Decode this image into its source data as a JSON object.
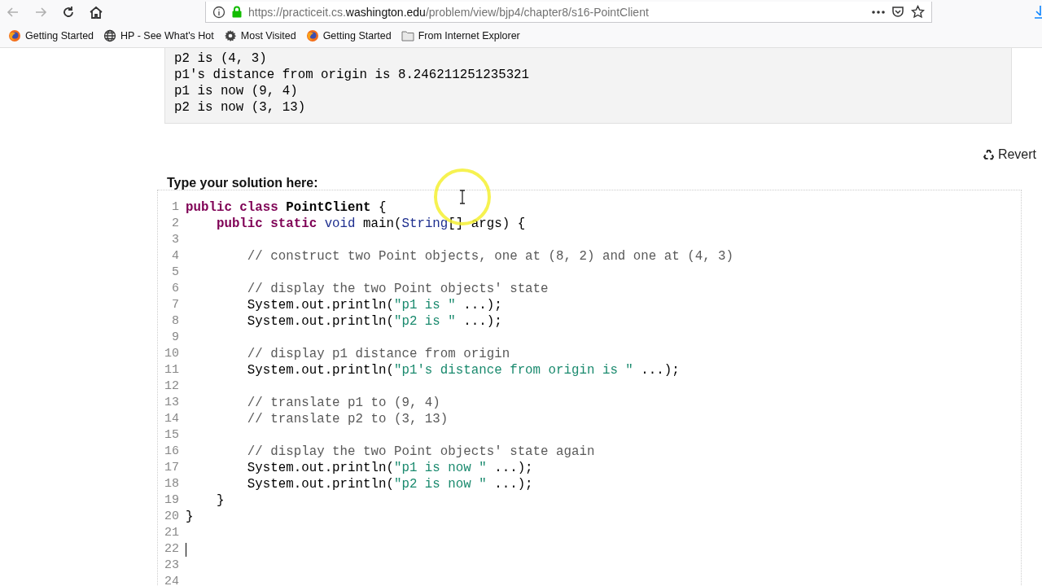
{
  "browser": {
    "url": {
      "prefix": "https://practiceit.cs.",
      "domain": "washington.edu",
      "path": "/problem/view/bjp4/chapter8/s16-PointClient"
    },
    "bookmarks": [
      {
        "kind": "firefox",
        "label": "Getting Started"
      },
      {
        "kind": "globe",
        "label": "HP - See What's Hot"
      },
      {
        "kind": "gear",
        "label": "Most Visited"
      },
      {
        "kind": "firefox",
        "label": "Getting Started"
      },
      {
        "kind": "folder",
        "label": "From Internet Explorer"
      }
    ]
  },
  "output": [
    "p2 is (4, 3)",
    "p1's distance from origin is 8.246211251235321",
    "p1 is now (9, 4)",
    "p2 is now (3, 13)"
  ],
  "revert_button": "Revert",
  "solution_label": "Type your solution here:",
  "editor": {
    "lines": [
      {
        "n": "1",
        "tokens": [
          {
            "kind": "keyword",
            "text": "public class "
          },
          {
            "kind": "name",
            "text": "PointClient"
          },
          {
            "kind": "plain",
            "text": " {"
          }
        ]
      },
      {
        "n": "2",
        "tokens": [
          {
            "kind": "keyword",
            "text": "    public static "
          },
          {
            "kind": "type",
            "text": "void"
          },
          {
            "kind": "plain",
            "text": " main("
          },
          {
            "kind": "type",
            "text": "String"
          },
          {
            "kind": "plain",
            "text": "[] args) {"
          }
        ]
      },
      {
        "n": "3"
      },
      {
        "n": "4",
        "tokens": [
          {
            "kind": "comment",
            "text": "        // construct two Point objects, one at (8, 2) and one at (4, 3)"
          }
        ]
      },
      {
        "n": "5"
      },
      {
        "n": "6",
        "tokens": [
          {
            "kind": "comment",
            "text": "        // display the two Point objects' state"
          }
        ]
      },
      {
        "n": "7",
        "tokens": [
          {
            "kind": "plain",
            "text": "        System.out.println("
          },
          {
            "kind": "string",
            "text": "\"p1 is \""
          },
          {
            "kind": "plain",
            "text": " ...);"
          }
        ]
      },
      {
        "n": "8",
        "tokens": [
          {
            "kind": "plain",
            "text": "        System.out.println("
          },
          {
            "kind": "string",
            "text": "\"p2 is \""
          },
          {
            "kind": "plain",
            "text": " ...);"
          }
        ]
      },
      {
        "n": "9"
      },
      {
        "n": "10",
        "tokens": [
          {
            "kind": "comment",
            "text": "        // display p1 distance from origin"
          }
        ]
      },
      {
        "n": "11",
        "tokens": [
          {
            "kind": "plain",
            "text": "        System.out.println("
          },
          {
            "kind": "string",
            "text": "\"p1's distance from origin is \""
          },
          {
            "kind": "plain",
            "text": " ...);"
          }
        ]
      },
      {
        "n": "12"
      },
      {
        "n": "13",
        "tokens": [
          {
            "kind": "comment",
            "text": "        // translate p1 to (9, 4)"
          }
        ]
      },
      {
        "n": "14",
        "tokens": [
          {
            "kind": "comment",
            "text": "        // translate p2 to (3, 13)"
          }
        ]
      },
      {
        "n": "15"
      },
      {
        "n": "16",
        "tokens": [
          {
            "kind": "comment",
            "text": "        // display the two Point objects' state again"
          }
        ]
      },
      {
        "n": "17",
        "tokens": [
          {
            "kind": "plain",
            "text": "        System.out.println("
          },
          {
            "kind": "string",
            "text": "\"p1 is now \""
          },
          {
            "kind": "plain",
            "text": " ...);"
          }
        ]
      },
      {
        "n": "18",
        "tokens": [
          {
            "kind": "plain",
            "text": "        System.out.println("
          },
          {
            "kind": "string",
            "text": "\"p2 is now \""
          },
          {
            "kind": "plain",
            "text": " ...);"
          }
        ]
      },
      {
        "n": "19",
        "tokens": [
          {
            "kind": "plain",
            "text": "    }"
          }
        ]
      },
      {
        "n": "20",
        "tokens": [
          {
            "kind": "plain",
            "text": "}"
          }
        ]
      },
      {
        "n": "21"
      },
      {
        "n": "22",
        "caret": true
      },
      {
        "n": "23"
      },
      {
        "n": "24"
      }
    ]
  }
}
